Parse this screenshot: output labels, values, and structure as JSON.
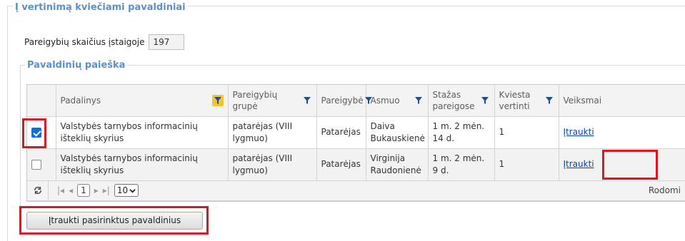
{
  "section": {
    "title": "Į vertinimą kviečiami pavaldiniai",
    "count_label": "Pareigybių skaičius įstaigoje",
    "count_value": "197"
  },
  "search": {
    "title": "Pavaldinių paieška"
  },
  "grid": {
    "columns": [
      {
        "label": "Padalinys",
        "filter_active": true
      },
      {
        "label": "Pareigybių grupė",
        "filter_active": false
      },
      {
        "label": "Pareigybė",
        "filter_active": false
      },
      {
        "label": "Asmuo",
        "filter_active": false
      },
      {
        "label": "Stažas pareigose",
        "filter_active": false
      },
      {
        "label": "Kviesta vertinti",
        "filter_active": false
      },
      {
        "label": "Veiksmai"
      }
    ],
    "rows": [
      {
        "checked": true,
        "padalinys": "Valstybės tarnybos informacinių išteklių skyrius",
        "grupe": "patarėjas (VIII lygmuo)",
        "pareigybe": "Patarėjas",
        "asmuo": "Daiva Bukauskienė",
        "stazas": "1 m. 2 mėn. 14 d.",
        "kviesta": "1",
        "veiksmas": "Įtraukti"
      },
      {
        "checked": false,
        "padalinys": "Valstybės tarnybos informacinių išteklių skyrius",
        "grupe": "patarėjas (VIII lygmuo)",
        "pareigybe": "Patarėjas",
        "asmuo": "Virginija Raudonienė",
        "stazas": "1 m. 2 mėn. 9 d.",
        "kviesta": "1",
        "veiksmas": "Įtraukti"
      }
    ],
    "pager": {
      "refresh_icon": "refresh-icon",
      "current_page": "1",
      "page_size": "10",
      "status_text": "Rodomi"
    }
  },
  "actions": {
    "add_selected_label": "Įtraukti pasirinktus pavaldinius"
  },
  "colors": {
    "legend": "#5b8fc9",
    "highlight": "#e0141e",
    "checkbox_checked": "#0b6fd6",
    "filter_active": "#f4c430"
  }
}
